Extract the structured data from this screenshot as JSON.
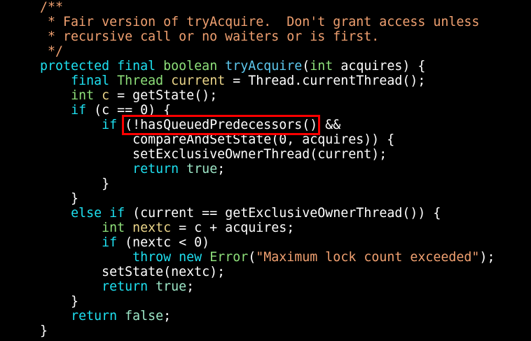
{
  "highlight_color": "#ff0000",
  "code": {
    "lines": [
      {
        "tokens": [
          {
            "text": "    /**",
            "k": "comment"
          }
        ]
      },
      {
        "tokens": [
          {
            "text": "     * Fair version of tryAcquire.  Don't grant access unless",
            "k": "comment"
          }
        ]
      },
      {
        "tokens": [
          {
            "text": "     * recursive call or no waiters or is first.",
            "k": "comment"
          }
        ]
      },
      {
        "tokens": [
          {
            "text": "     */",
            "k": "comment"
          }
        ]
      },
      {
        "tokens": [
          {
            "text": "    ",
            "k": "plain"
          },
          {
            "text": "protected",
            "k": "kw"
          },
          {
            "text": " ",
            "k": "plain"
          },
          {
            "text": "final",
            "k": "kw"
          },
          {
            "text": " ",
            "k": "plain"
          },
          {
            "text": "boolean",
            "k": "type"
          },
          {
            "text": " ",
            "k": "plain"
          },
          {
            "text": "tryAcquire",
            "k": "fn"
          },
          {
            "text": "(",
            "k": "plain"
          },
          {
            "text": "int",
            "k": "type"
          },
          {
            "text": " acquires) {",
            "k": "plain"
          }
        ]
      },
      {
        "tokens": [
          {
            "text": "        ",
            "k": "plain"
          },
          {
            "text": "final",
            "k": "kw"
          },
          {
            "text": " ",
            "k": "plain"
          },
          {
            "text": "Thread",
            "k": "type"
          },
          {
            "text": " ",
            "k": "plain"
          },
          {
            "text": "current",
            "k": "var"
          },
          {
            "text": " = Thread.currentThread();",
            "k": "plain"
          }
        ]
      },
      {
        "tokens": [
          {
            "text": "        ",
            "k": "plain"
          },
          {
            "text": "int",
            "k": "type"
          },
          {
            "text": " ",
            "k": "plain"
          },
          {
            "text": "c",
            "k": "var"
          },
          {
            "text": " = getState();",
            "k": "plain"
          }
        ]
      },
      {
        "tokens": [
          {
            "text": "        ",
            "k": "plain"
          },
          {
            "text": "if",
            "k": "kw"
          },
          {
            "text": " (c == 0) {",
            "k": "plain"
          }
        ]
      },
      {
        "tokens": [
          {
            "text": "            ",
            "k": "plain"
          },
          {
            "text": "if",
            "k": "kw"
          },
          {
            "text": " ",
            "k": "plain"
          },
          {
            "text": "(!hasQueuedPredecessors()",
            "k": "plain",
            "hl": true
          },
          {
            "text": " &&",
            "k": "plain"
          }
        ]
      },
      {
        "tokens": [
          {
            "text": "                compareAndSetState(0, acquires)) {",
            "k": "plain"
          }
        ]
      },
      {
        "tokens": [
          {
            "text": "                setExclusiveOwnerThread(current);",
            "k": "plain"
          }
        ]
      },
      {
        "tokens": [
          {
            "text": "                ",
            "k": "plain"
          },
          {
            "text": "return",
            "k": "kw"
          },
          {
            "text": " ",
            "k": "plain"
          },
          {
            "text": "true",
            "k": "lit"
          },
          {
            "text": ";",
            "k": "plain"
          }
        ]
      },
      {
        "tokens": [
          {
            "text": "            }",
            "k": "plain"
          }
        ]
      },
      {
        "tokens": [
          {
            "text": "        }",
            "k": "plain"
          }
        ]
      },
      {
        "tokens": [
          {
            "text": "        ",
            "k": "plain"
          },
          {
            "text": "else",
            "k": "kw"
          },
          {
            "text": " ",
            "k": "plain"
          },
          {
            "text": "if",
            "k": "kw"
          },
          {
            "text": " (current == getExclusiveOwnerThread()) {",
            "k": "plain"
          }
        ]
      },
      {
        "tokens": [
          {
            "text": "            ",
            "k": "plain"
          },
          {
            "text": "int",
            "k": "type"
          },
          {
            "text": " ",
            "k": "plain"
          },
          {
            "text": "nextc",
            "k": "var"
          },
          {
            "text": " = c + acquires;",
            "k": "plain"
          }
        ]
      },
      {
        "tokens": [
          {
            "text": "            ",
            "k": "plain"
          },
          {
            "text": "if",
            "k": "kw"
          },
          {
            "text": " (nextc < 0)",
            "k": "plain"
          }
        ]
      },
      {
        "tokens": [
          {
            "text": "                ",
            "k": "plain"
          },
          {
            "text": "throw",
            "k": "kw"
          },
          {
            "text": " ",
            "k": "plain"
          },
          {
            "text": "new",
            "k": "kw"
          },
          {
            "text": " ",
            "k": "plain"
          },
          {
            "text": "Error",
            "k": "type"
          },
          {
            "text": "(",
            "k": "plain"
          },
          {
            "text": "\"Maximum lock count exceeded\"",
            "k": "str"
          },
          {
            "text": ");",
            "k": "plain"
          }
        ]
      },
      {
        "tokens": [
          {
            "text": "            setState(nextc);",
            "k": "plain"
          }
        ]
      },
      {
        "tokens": [
          {
            "text": "            ",
            "k": "plain"
          },
          {
            "text": "return",
            "k": "kw"
          },
          {
            "text": " ",
            "k": "plain"
          },
          {
            "text": "true",
            "k": "lit"
          },
          {
            "text": ";",
            "k": "plain"
          }
        ]
      },
      {
        "tokens": [
          {
            "text": "        }",
            "k": "plain"
          }
        ]
      },
      {
        "tokens": [
          {
            "text": "        ",
            "k": "plain"
          },
          {
            "text": "return",
            "k": "kw"
          },
          {
            "text": " ",
            "k": "plain"
          },
          {
            "text": "false",
            "k": "lit"
          },
          {
            "text": ";",
            "k": "plain"
          }
        ]
      },
      {
        "tokens": [
          {
            "text": "    }",
            "k": "plain"
          }
        ]
      }
    ]
  }
}
